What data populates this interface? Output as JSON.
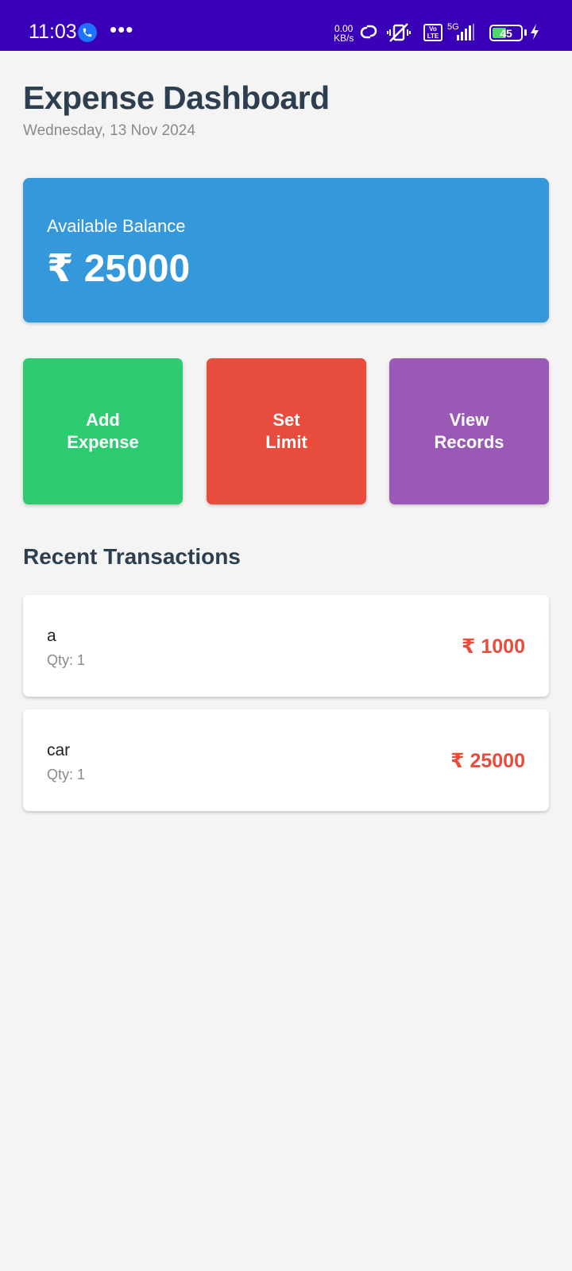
{
  "status_bar": {
    "time": "11:03",
    "dots": "•••",
    "network_speed_value": "0.00",
    "network_speed_unit": "KB/s",
    "volte_label": "Vo LTE",
    "network_type": "5G",
    "battery_level": "45",
    "icons": [
      "call-icon",
      "link-icon",
      "vibrate-off-icon",
      "volte-icon",
      "signal-icon",
      "battery-icon",
      "charging-icon"
    ]
  },
  "header": {
    "title": "Expense Dashboard",
    "date": "Wednesday, 13 Nov 2024"
  },
  "balance": {
    "label": "Available Balance",
    "amount": "₹ 25000"
  },
  "actions": {
    "add_expense": {
      "line1": "Add",
      "line2": "Expense"
    },
    "set_limit": {
      "line1": "Set",
      "line2": "Limit"
    },
    "view_records": {
      "line1": "View",
      "line2": "Records"
    }
  },
  "recent": {
    "title": "Recent Transactions",
    "items": [
      {
        "name": "a",
        "qty": "Qty: 1",
        "amount": "₹ 1000"
      },
      {
        "name": "car",
        "qty": "Qty: 1",
        "amount": "₹ 25000"
      }
    ]
  },
  "colors": {
    "status_bar": "#3a00b8",
    "balance_card": "#3498db",
    "add_expense": "#2ecc71",
    "set_limit": "#e74c3c",
    "view_records": "#9b59b6",
    "amount_text": "#e74c3c",
    "heading_text": "#2c3e50"
  }
}
